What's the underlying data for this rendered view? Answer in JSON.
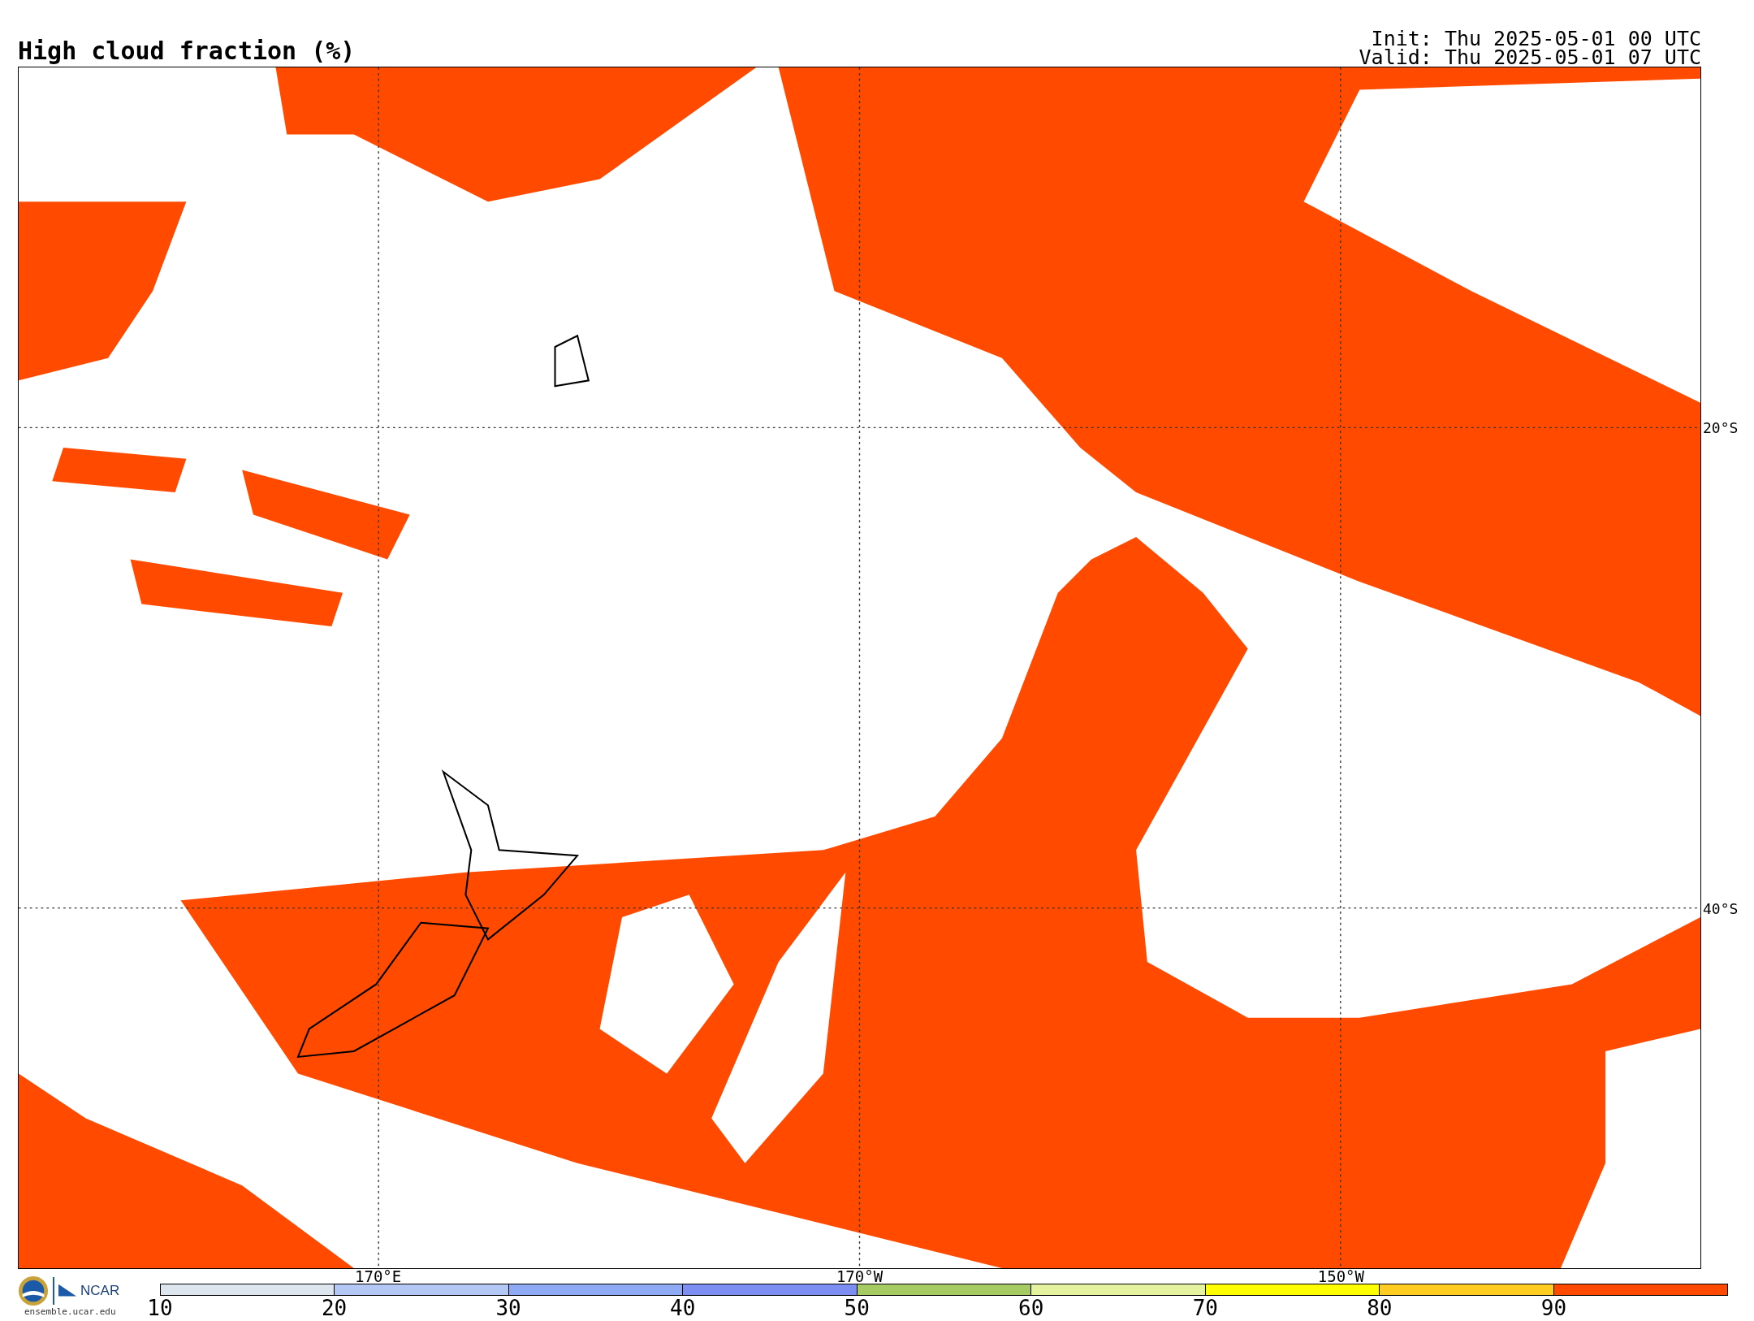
{
  "title": "High cloud fraction (%)",
  "run_info": [
    "Init: Thu 2025-05-01 00 UTC",
    "Valid: Thu 2025-05-01 07 UTC"
  ],
  "map": {
    "lon_labels": [
      "170°E",
      "170°W",
      "150°W"
    ],
    "lat_labels": [
      "20°S",
      "40°S"
    ]
  },
  "logo": {
    "name": "NCAR",
    "url": "ensemble.ucar.edu"
  },
  "colorbar": {
    "segments": [
      {
        "color": "#dde6ee"
      },
      {
        "color": "#b4c8f5"
      },
      {
        "color": "#8eaaf5"
      },
      {
        "color": "#7c8ef2"
      },
      {
        "color": "#a6cb62"
      },
      {
        "color": "#e5f2a0"
      },
      {
        "color": "#ffff00"
      },
      {
        "color": "#ffcc22"
      },
      {
        "color": "#ff4a00"
      }
    ],
    "ticks": [
      "10",
      "20",
      "30",
      "40",
      "50",
      "60",
      "70",
      "80",
      "90"
    ]
  }
}
